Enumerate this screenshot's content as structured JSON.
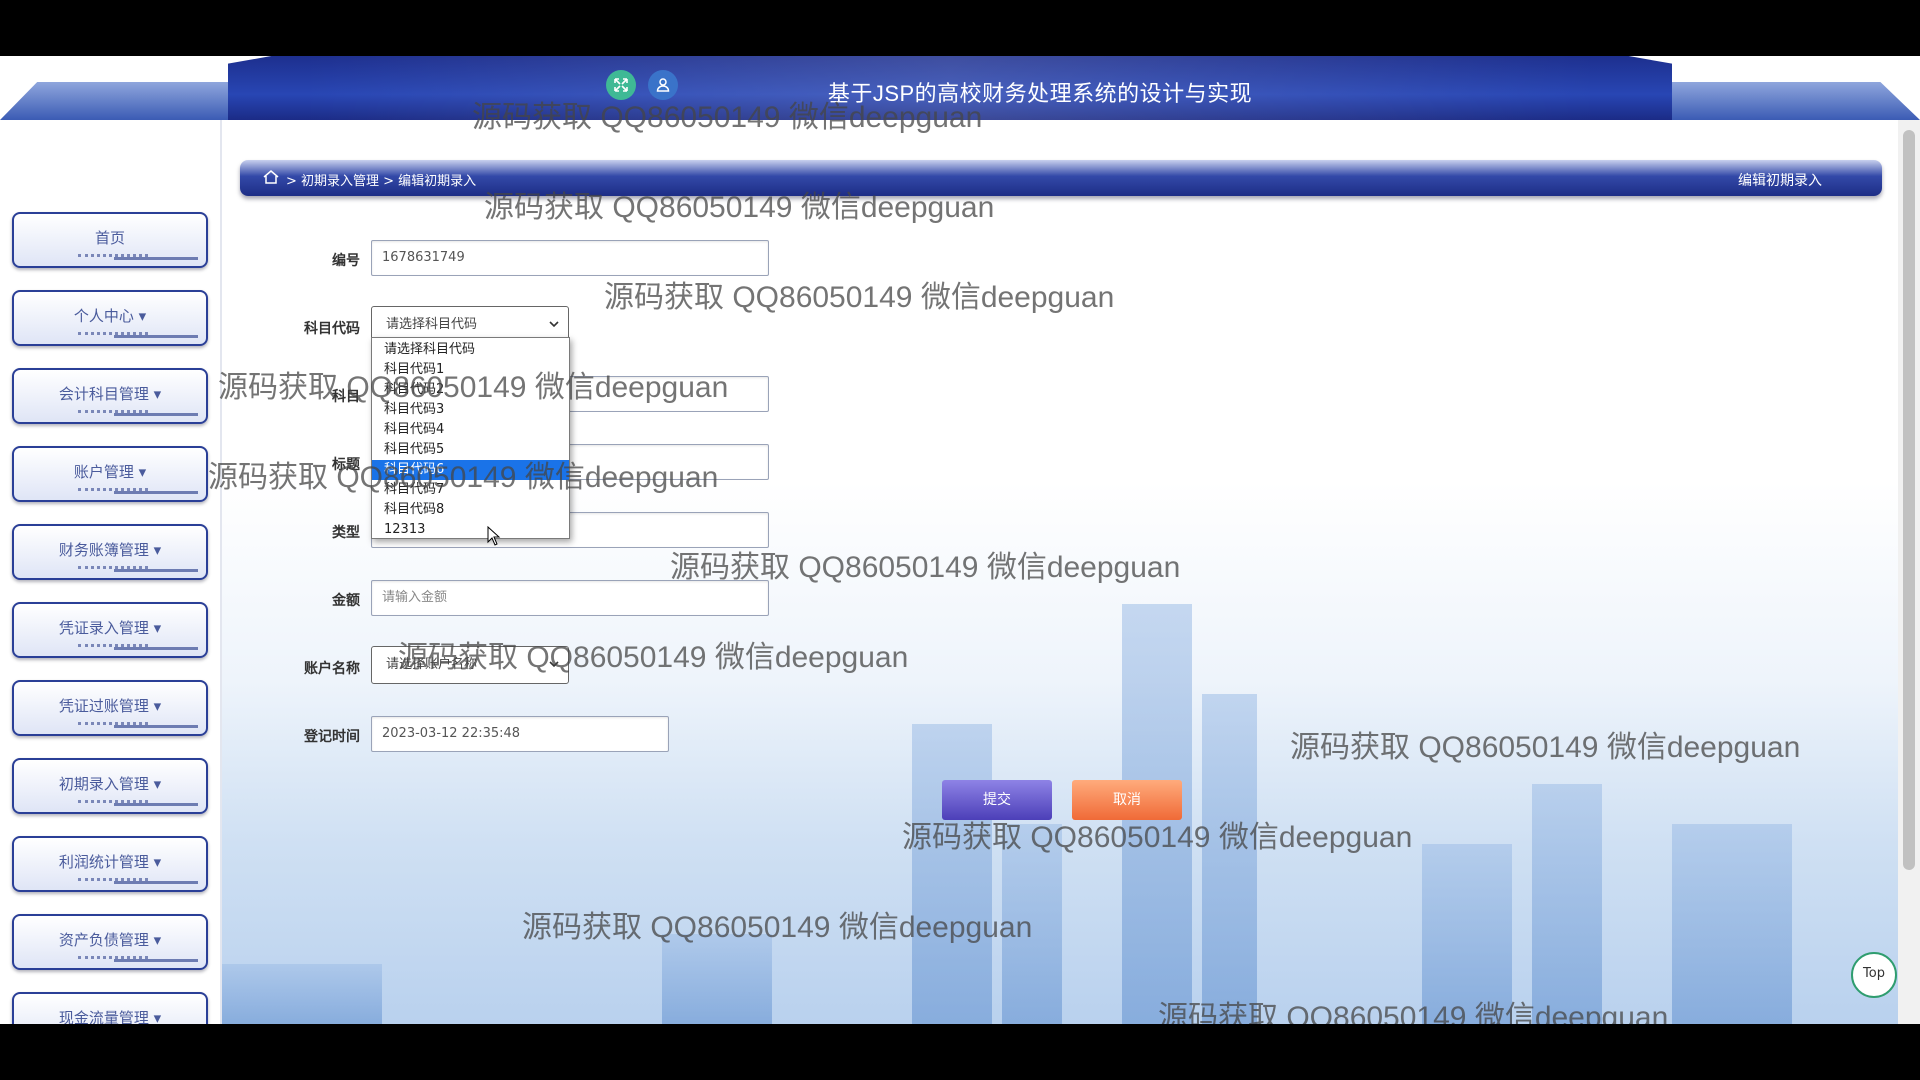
{
  "header": {
    "title": "基于JSP的高校财务处理系统的设计与实现",
    "icons": [
      "fullscreen-icon",
      "user-icon"
    ]
  },
  "sidebar": {
    "items": [
      {
        "label": "首页"
      },
      {
        "label": "个人中心 ▾"
      },
      {
        "label": "会计科目管理 ▾"
      },
      {
        "label": "账户管理 ▾"
      },
      {
        "label": "财务账簿管理 ▾"
      },
      {
        "label": "凭证录入管理 ▾"
      },
      {
        "label": "凭证过账管理 ▾"
      },
      {
        "label": "初期录入管理 ▾"
      },
      {
        "label": "利润统计管理 ▾"
      },
      {
        "label": "资产负债管理 ▾"
      },
      {
        "label": "现金流量管理 ▾"
      }
    ]
  },
  "breadcrumb": {
    "path": "> 初期录入管理 > 编辑初期录入",
    "current": "编辑初期录入"
  },
  "form": {
    "number_label": "编号",
    "number_value": "1678631749",
    "subject_code_label": "科目代码",
    "subject_code_placeholder": "请选择科目代码",
    "subject_label": "科目",
    "title_label": "标题",
    "type_label": "类型",
    "amount_label": "金额",
    "amount_placeholder": "请输入金额",
    "account_name_label": "账户名称",
    "account_name_placeholder": "请选择账户名称",
    "reg_time_label": "登记时间",
    "reg_time_value": "2023-03-12 22:35:48"
  },
  "dropdown": {
    "options": [
      "请选择科目代码",
      "科目代码1",
      "科目代码2",
      "科目代码3",
      "科目代码4",
      "科目代码5",
      "科目代码6",
      "科目代码7",
      "科目代码8",
      "12313"
    ],
    "highlighted": "科目代码6"
  },
  "buttons": {
    "submit": "提交",
    "cancel": "取消",
    "top": "Top"
  },
  "watermark": "源码获取 QQ86050149 微信deepguan"
}
